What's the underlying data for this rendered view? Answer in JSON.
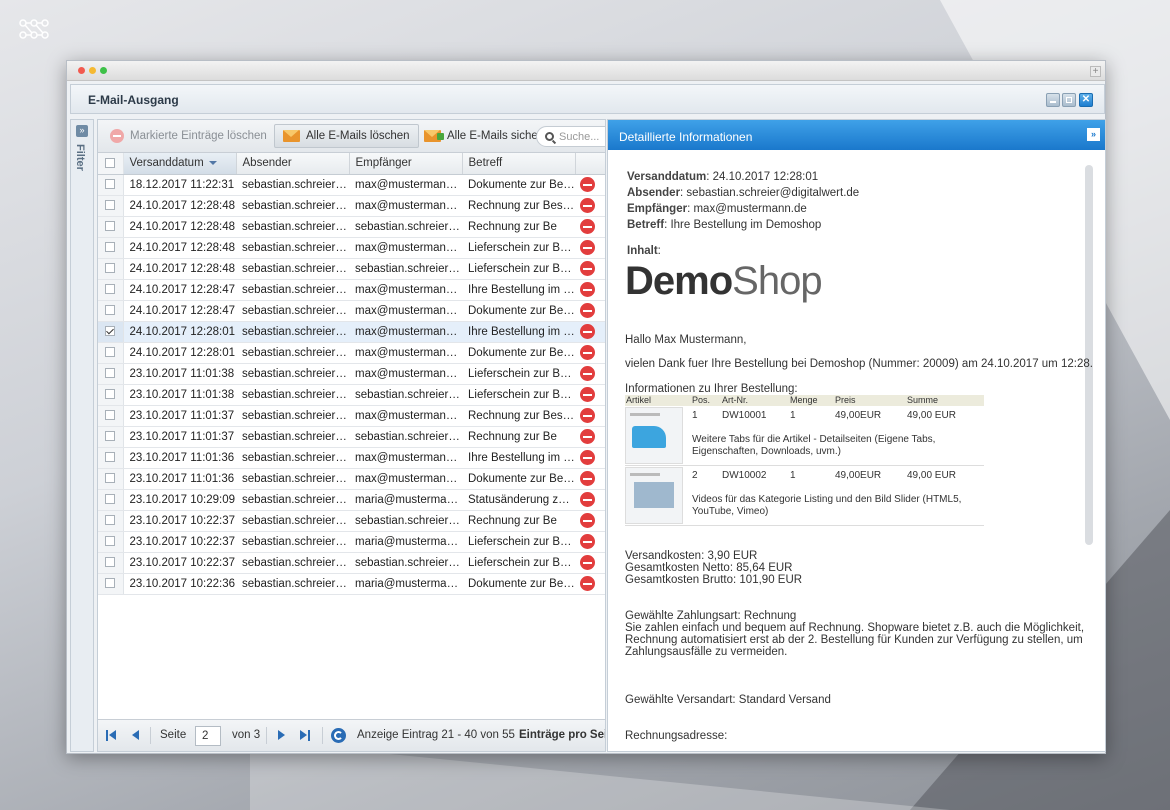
{
  "window": {
    "title": "E-Mail-Ausgang"
  },
  "filter": {
    "label": "Filter",
    "toggle": "»"
  },
  "toolbar": {
    "delete_marked": "Markierte Einträge löschen",
    "delete_all": "Alle E-Mails löschen",
    "save_all": "Alle E-Mails sicher",
    "search_placeholder": "Suche..."
  },
  "grid": {
    "columns": [
      "Versanddatum",
      "Absender",
      "Empfänger",
      "Betreff"
    ],
    "rows": [
      {
        "date": "18.12.2017 11:22:31",
        "sender": "sebastian.schreier@digitalwert.de",
        "recipient": "max@mustermann.de",
        "subject": "Dokumente zur Bestellung",
        "checked": false
      },
      {
        "date": "24.10.2017 12:28:48",
        "sender": "sebastian.schreier@digitalwert.de",
        "recipient": "max@mustermann.de",
        "subject": "Rechnung zur Bestellung",
        "checked": false
      },
      {
        "date": "24.10.2017 12:28:48",
        "sender": "sebastian.schreier@digitalwert.de",
        "recipient": "sebastian.schreier@digitalwert.de",
        "subject": "Rechnung zur Be",
        "checked": false
      },
      {
        "date": "24.10.2017 12:28:48",
        "sender": "sebastian.schreier@digitalwert.de",
        "recipient": "max@mustermann.de",
        "subject": "Lieferschein zur Bestellung",
        "checked": false
      },
      {
        "date": "24.10.2017 12:28:48",
        "sender": "sebastian.schreier@digitalwert.de",
        "recipient": "sebastian.schreier@digitalwert.de",
        "subject": "Lieferschein zur Bestellung",
        "checked": false
      },
      {
        "date": "24.10.2017 12:28:47",
        "sender": "sebastian.schreier@digitalwert.de",
        "recipient": "max@mustermann.de",
        "subject": "Ihre Bestellung im Demoshop",
        "checked": false
      },
      {
        "date": "24.10.2017 12:28:47",
        "sender": "sebastian.schreier@digitalwert.de",
        "recipient": "max@mustermann.de",
        "subject": "Dokumente zur Bestellung",
        "checked": false
      },
      {
        "date": "24.10.2017 12:28:01",
        "sender": "sebastian.schreier@digitalwert.de",
        "recipient": "max@mustermann.de",
        "subject": "Ihre Bestellung im Demoshop",
        "checked": true
      },
      {
        "date": "24.10.2017 12:28:01",
        "sender": "sebastian.schreier@digitalwert.de",
        "recipient": "max@mustermann.de",
        "subject": "Dokumente zur Bestellung",
        "checked": false
      },
      {
        "date": "23.10.2017 11:01:38",
        "sender": "sebastian.schreier@digitalwert.de",
        "recipient": "max@mustermann.de",
        "subject": "Lieferschein zur Bestellung",
        "checked": false
      },
      {
        "date": "23.10.2017 11:01:38",
        "sender": "sebastian.schreier@digitalwert.de",
        "recipient": "sebastian.schreier@digitalwert.de",
        "subject": "Lieferschein zur Bestellung",
        "checked": false
      },
      {
        "date": "23.10.2017 11:01:37",
        "sender": "sebastian.schreier@digitalwert.de",
        "recipient": "max@mustermann.de",
        "subject": "Rechnung zur Bestellung",
        "checked": false
      },
      {
        "date": "23.10.2017 11:01:37",
        "sender": "sebastian.schreier@digitalwert.de",
        "recipient": "sebastian.schreier@digitalwert.de",
        "subject": "Rechnung zur Be",
        "checked": false
      },
      {
        "date": "23.10.2017 11:01:36",
        "sender": "sebastian.schreier@digitalwert.de",
        "recipient": "max@mustermann.de",
        "subject": "Ihre Bestellung im Demoshop",
        "checked": false
      },
      {
        "date": "23.10.2017 11:01:36",
        "sender": "sebastian.schreier@digitalwert.de",
        "recipient": "max@mustermann.de",
        "subject": "Dokumente zur Bestellung",
        "checked": false
      },
      {
        "date": "23.10.2017 10:29:09",
        "sender": "sebastian.schreier@digitalwert.de",
        "recipient": "maria@mustermann.de",
        "subject": "Statusänderung zur Bestellung",
        "checked": false
      },
      {
        "date": "23.10.2017 10:22:37",
        "sender": "sebastian.schreier@digitalwert.de",
        "recipient": "sebastian.schreier@digitalwert.de",
        "subject": "Rechnung zur Be",
        "checked": false
      },
      {
        "date": "23.10.2017 10:22:37",
        "sender": "sebastian.schreier@digitalwert.de",
        "recipient": "maria@mustermann.de",
        "subject": "Lieferschein zur Bestellung",
        "checked": false
      },
      {
        "date": "23.10.2017 10:22:37",
        "sender": "sebastian.schreier@digitalwert.de",
        "recipient": "sebastian.schreier@digitalwert.de",
        "subject": "Lieferschein zur Bestellung",
        "checked": false
      },
      {
        "date": "23.10.2017 10:22:36",
        "sender": "sebastian.schreier@digitalwert.de",
        "recipient": "maria@mustermann.de",
        "subject": "Dokumente zur Bestellung",
        "checked": false
      }
    ]
  },
  "pager": {
    "page_label": "Seite",
    "page": "2",
    "of_label": "von 3",
    "display": "Anzeige Eintrag 21 - 40 von 55",
    "per_page_label": "Einträge pro Seite"
  },
  "detail": {
    "header": "Detaillierte Informationen",
    "collapse": "»",
    "versanddatum_label": "Versanddatum",
    "versanddatum": ": 24.10.2017 12:28:01",
    "absender_label": "Absender",
    "absender": ": sebastian.schreier@digitalwert.de",
    "empfaenger_label": "Empfänger",
    "empfaenger": ": max@mustermann.de",
    "betreff_label": "Betreff",
    "betreff": ": Ihre Bestellung im Demoshop",
    "inhalt_label": "Inhalt",
    "inhalt_colon": ":",
    "logo_bold": "Demo",
    "logo_light": "Shop",
    "greeting": "Hallo Max Mustermann,",
    "thanks": "vielen Dank fuer Ihre Bestellung bei Demoshop (Nummer: 20009) am 24.10.2017 um 12:28.",
    "info_heading": "Informationen zu Ihrer Bestellung:",
    "order_columns": [
      "Artikel",
      "Pos.",
      "Art-Nr.",
      "Menge",
      "Preis",
      "Summe"
    ],
    "order_items": [
      {
        "pos": "1",
        "artnr": "DW10001",
        "menge": "1",
        "preis": "49,00EUR",
        "summe": "49,00 EUR",
        "desc": "Weitere Tabs für die Artikel - Detailseiten (Eigene Tabs, Eigenschaften, Downloads, uvm.)"
      },
      {
        "pos": "2",
        "artnr": "DW10002",
        "menge": "1",
        "preis": "49,00EUR",
        "summe": "49,00 EUR",
        "desc": "Videos für das Kategorie Listing und den Bild Slider (HTML5, YouTube, Vimeo)"
      }
    ],
    "versandkosten": "Versandkosten: 3,90 EUR",
    "netto": "Gesamtkosten Netto: 85,64 EUR",
    "brutto": "Gesamtkosten Brutto: 101,90 EUR",
    "zahlungsart": "Gewählte Zahlungsart: Rechnung",
    "zahlung_text1": "Sie zahlen einfach und bequem auf Rechnung. Shopware bietet z.B. auch die Möglichkeit,",
    "zahlung_text2": "Rechnung automatisiert erst ab der 2. Bestellung für Kunden zur Verfügung zu stellen, um",
    "zahlung_text3": "Zahlungsausfälle zu vermeiden.",
    "versandart": "Gewählte Versandart: Standard Versand",
    "rechnungsadresse": "Rechnungsadresse:"
  }
}
